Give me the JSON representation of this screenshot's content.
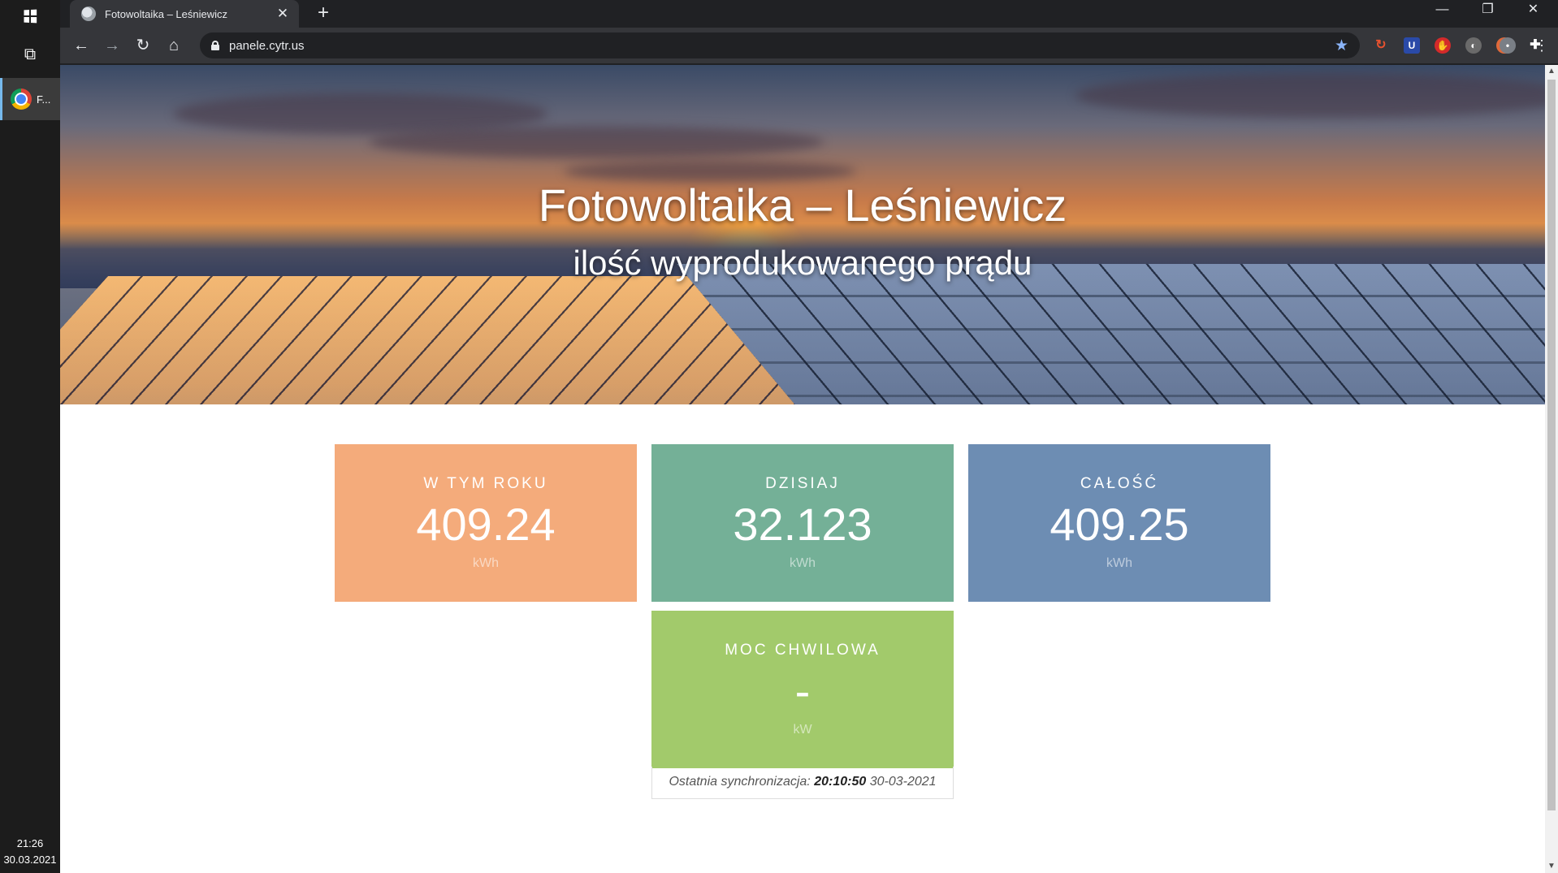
{
  "taskbar": {
    "app_label": "F...",
    "time": "21:26",
    "date": "30.03.2021"
  },
  "browser": {
    "tab_title": "Fotowoltaika – Leśniewicz",
    "tab_close": "✕",
    "new_tab": "+",
    "url": "panele.cytr.us",
    "window_controls": {
      "minimize": "—",
      "restore": "❐",
      "close": "✕"
    }
  },
  "hero": {
    "title": "Fotowoltaika – Leśniewicz",
    "subtitle": "ilość wyprodukowanego prądu"
  },
  "cards": [
    {
      "label": "W TYM ROKU",
      "value": "409.24",
      "unit": "kWh",
      "color": "#f4ab7b"
    },
    {
      "label": "DZISIAJ",
      "value": "32.123",
      "unit": "kWh",
      "color": "#74b097"
    },
    {
      "label": "CAŁOŚĆ",
      "value": "409.25",
      "unit": "kWh",
      "color": "#6d8db3"
    },
    {
      "label": "MOC CHWILOWA",
      "value": "-",
      "unit": "kW",
      "color": "#a2ca6b"
    }
  ],
  "sync": {
    "prefix": "Ostatnia synchronizacja:",
    "time": "20:10:50",
    "date": "30-03-2021"
  },
  "icons": [
    "windows-start-icon",
    "task-view-icon",
    "chrome-icon",
    "back-icon",
    "forward-icon",
    "reload-icon",
    "home-icon",
    "lock-icon",
    "bookmark-star-icon",
    "extension-icons",
    "profile-avatar",
    "menu-dots-icon"
  ]
}
